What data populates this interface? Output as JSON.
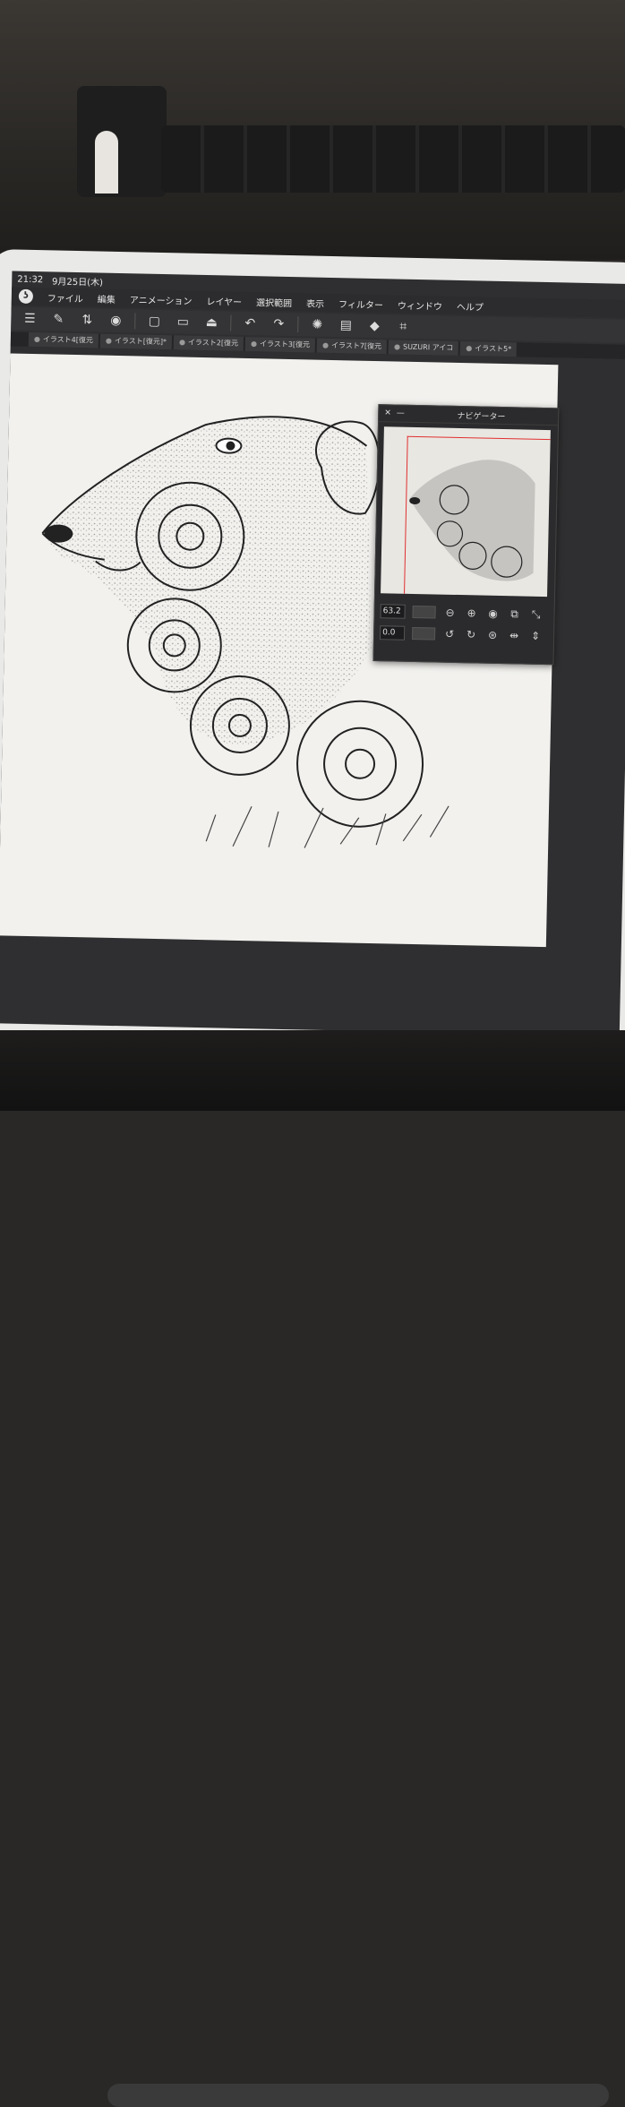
{
  "status": {
    "time": "21:32",
    "date": "9月25日(木)"
  },
  "menu": {
    "items": [
      "ファイル",
      "編集",
      "アニメーション",
      "レイヤー",
      "選択範囲",
      "表示",
      "フィルター",
      "ウィンドウ",
      "ヘルプ"
    ]
  },
  "toolbar": {
    "icons": [
      "menu-icon",
      "new-icon",
      "switch-icon",
      "record-icon",
      "new-file-icon",
      "open-folder-icon",
      "save-icon",
      "undo-icon",
      "redo-icon",
      "loading-icon",
      "fill-icon",
      "crop-icon"
    ]
  },
  "tabs": [
    "イラスト4[復元",
    "イラスト[復元]*",
    "イラスト2[復元",
    "イラスト3[復元",
    "イラスト7[復元",
    "SUZURI アイコ",
    "イラスト5*"
  ],
  "navigator": {
    "title": "ナビゲーター",
    "zoom": "63.2",
    "rotation": "0.0"
  }
}
